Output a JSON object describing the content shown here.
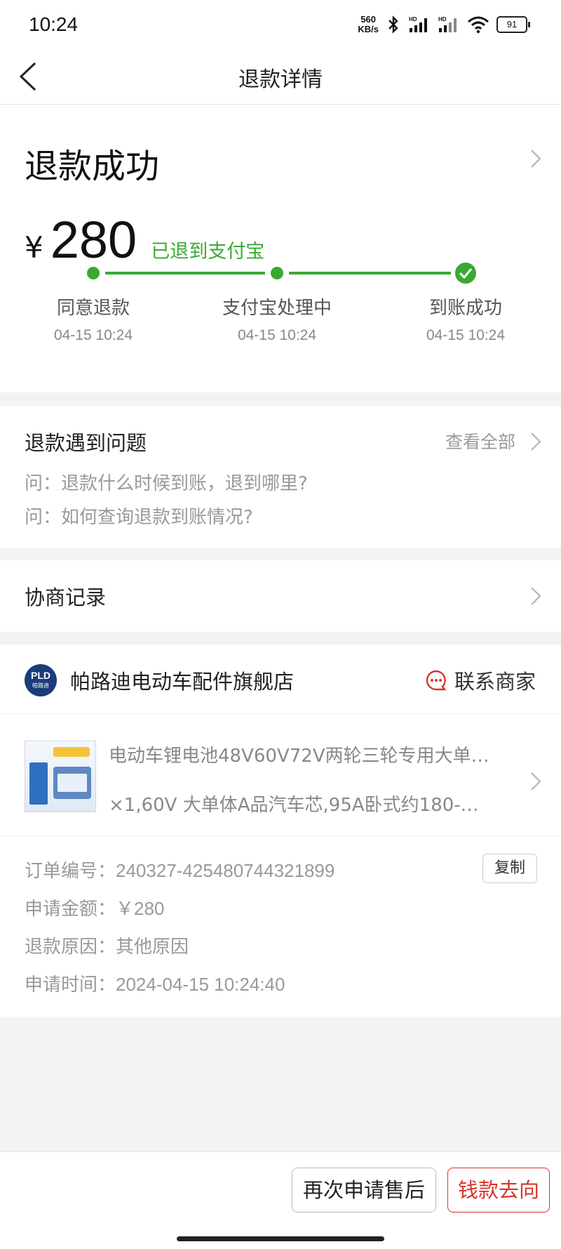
{
  "status_bar": {
    "time": "10:24",
    "net_speed_top": "560",
    "net_speed_bottom": "KB/s",
    "battery": "91",
    "signal_label": "HD"
  },
  "navbar": {
    "title": "退款详情"
  },
  "refund": {
    "status": "退款成功",
    "currency": "¥",
    "amount": "280",
    "destination": "已退到支付宝",
    "steps": [
      {
        "label": "同意退款",
        "time": "04-15 10:24"
      },
      {
        "label": "支付宝处理中",
        "time": "04-15 10:24"
      },
      {
        "label": "到账成功",
        "time": "04-15 10:24"
      }
    ],
    "colors": {
      "accent": "#3aa932"
    }
  },
  "problems": {
    "title": "退款遇到问题",
    "see_all": "查看全部",
    "questions": [
      "问：退款什么时候到账，退到哪里?",
      "问：如何查询退款到账情况?"
    ]
  },
  "negotiation": {
    "title": "协商记录"
  },
  "store": {
    "logo_text": "PLD",
    "logo_sub": "帕路迪",
    "name": "帕路迪电动车配件旗舰店",
    "contact_label": "联系商家",
    "product_title": "电动车锂电池48V60V72V两轮三轮专用大单…",
    "product_sku": "×1,60V 大单体A品汽车芯,95A卧式约180-…",
    "order": {
      "order_no_label": "订单编号：",
      "order_no": "240327-425480744321899",
      "copy_label": "复制",
      "amount_label": "申请金额：",
      "amount": "￥280",
      "reason_label": "退款原因：",
      "reason": "其他原因",
      "time_label": "申请时间：",
      "time": "2024-04-15 10:24:40"
    }
  },
  "bottom": {
    "apply_again": "再次申请售后",
    "money_where": "钱款去向",
    "colors": {
      "danger": "#d9342b"
    }
  }
}
